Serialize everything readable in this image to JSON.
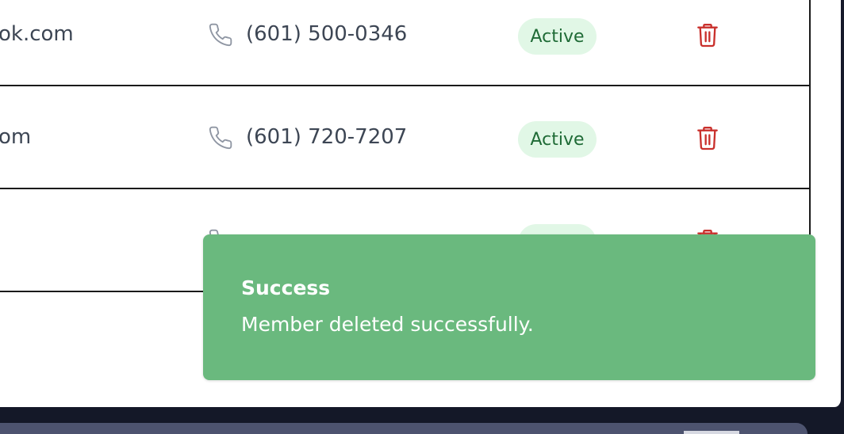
{
  "table": {
    "rows": [
      {
        "email": "ok.com",
        "phone": "(601) 500-0346",
        "status": "Active"
      },
      {
        "email": "om",
        "phone": "(601) 720-7207",
        "status": "Active"
      },
      {
        "email": "",
        "phone": "",
        "status": ""
      }
    ]
  },
  "toast": {
    "title": "Success",
    "message": "Member deleted successfully."
  },
  "colors": {
    "toast_bg": "#6ab97e",
    "badge_bg": "#e1f7e6",
    "badge_text": "#1f6b36",
    "delete_icon": "#c9302c"
  },
  "icons": {
    "phone": "phone-icon",
    "delete": "trash-icon"
  }
}
